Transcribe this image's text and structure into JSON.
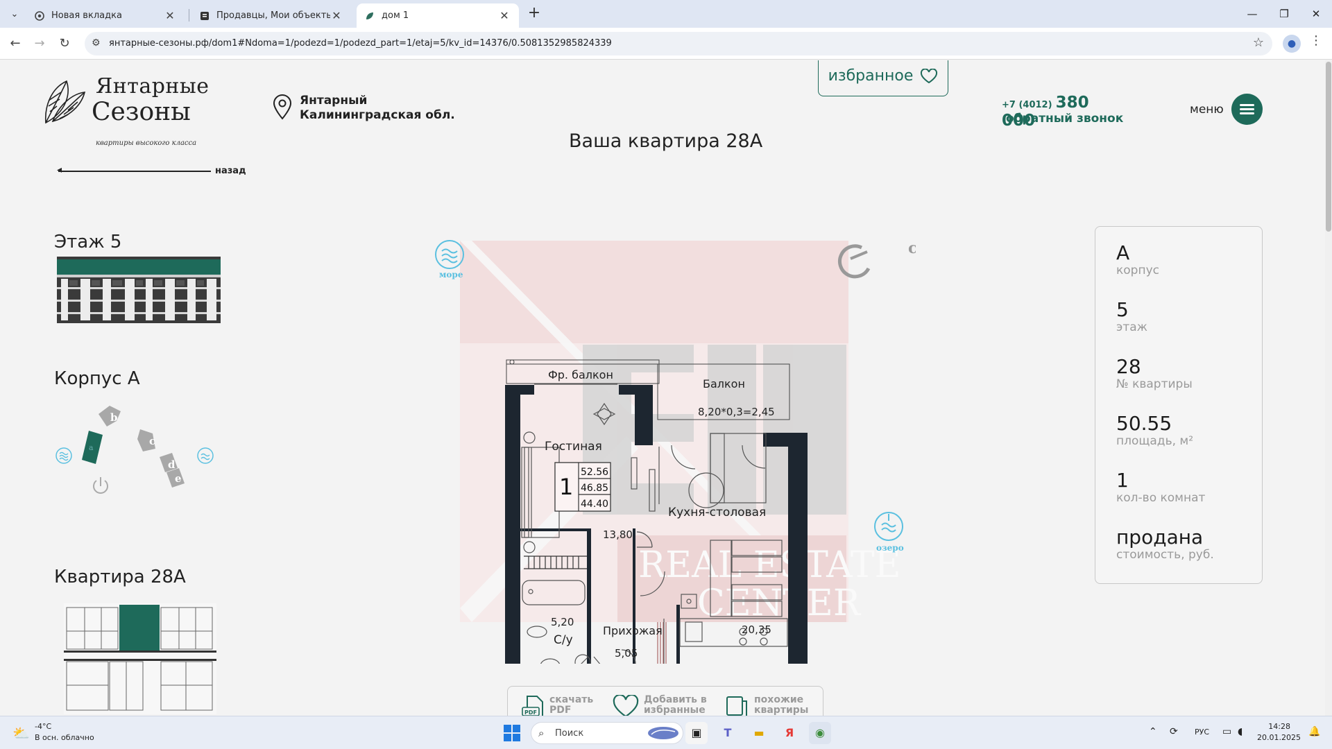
{
  "browser": {
    "tabs": [
      {
        "title": "Новая вкладка",
        "active": false
      },
      {
        "title": "Продавцы, Мои объекты",
        "active": false
      },
      {
        "title": "дом 1",
        "active": true
      }
    ],
    "new_tab": "+",
    "url": "янтарные-сезоны.рф/dom1#Ndoma=1/podezd=1/podezd_part=1/etaj=5/kv_id=14376/0.5081352985824339",
    "window_controls": {
      "minimize": "—",
      "restore": "❐",
      "close": "✕"
    }
  },
  "header": {
    "logo": {
      "line1": "Янтарные",
      "line2": "Сезоны",
      "tagline": "квартиры высокого класса"
    },
    "location": {
      "line1": "Янтарный",
      "line2": "Калининградская обл."
    },
    "favorites_label": "избранное",
    "phone_prefix": "+7 (4012)",
    "phone_main": "380 000",
    "callback_label": "обратный звонок",
    "menu_label": "меню"
  },
  "page_title": "Ваша квартира 28А",
  "back_label": "назад",
  "sidebar": {
    "floor_heading": "Этаж 5",
    "corpus_heading": "Корпус А",
    "corpus_buildings": [
      "a",
      "b",
      "c",
      "d",
      "e"
    ],
    "apartment_heading": "Квартира 28А"
  },
  "plan": {
    "landmarks": {
      "sea": "море",
      "lake": "озеро",
      "center": "с"
    },
    "watermark": {
      "line1": "REAL ESTATE",
      "line2": "CENTER"
    },
    "rooms": {
      "fr_balcony": "Фр. балкон",
      "balcony": "Балкон",
      "balcony_area": "8,20*0,3=2,45",
      "living": "Гостиная",
      "kitchen": "Кухня-столовая",
      "living_area": "13,80",
      "bath_area": "5,20",
      "bath": "С/у",
      "hall": "Прихожая",
      "hall_area": "5,05",
      "kitchen_area": "20,35"
    },
    "summary": {
      "rooms": "1",
      "total": "52.56",
      "living_total": "46.85",
      "net": "44.40"
    }
  },
  "info": [
    {
      "value": "А",
      "label": "корпус"
    },
    {
      "value": "5",
      "label": "этаж"
    },
    {
      "value": "28",
      "label": "№ квартиры"
    },
    {
      "value": "50.55",
      "label": "площадь, м²"
    },
    {
      "value": "1",
      "label": "кол-во комнат"
    },
    {
      "value": "продана",
      "label": "стоимость, руб."
    }
  ],
  "actions": {
    "pdf": "скачать PDF",
    "favorite": "Добавить в избранные",
    "similar": "похожие квартиры"
  },
  "taskbar": {
    "weather_temp": "-4°C",
    "weather_desc": "В осн. облачно",
    "search_placeholder": "Поиск",
    "lang": "РУС",
    "time": "14:28",
    "date": "20.01.2025"
  },
  "colors": {
    "brand": "#1e6a5a",
    "accent_light": "#5bc0e0"
  }
}
